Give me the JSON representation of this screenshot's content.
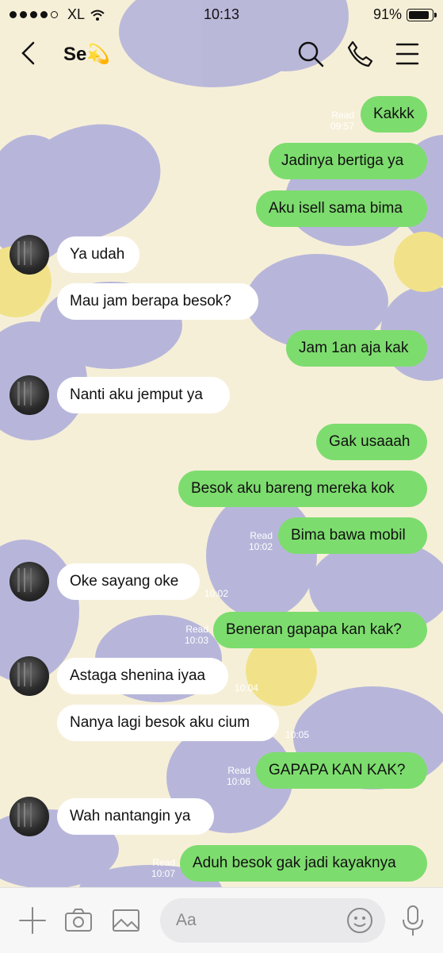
{
  "status_bar": {
    "carrier": "XL",
    "time": "10:13",
    "battery": "91%",
    "battery_level": 0.91
  },
  "header": {
    "title": "Se💫"
  },
  "messages": [
    {
      "side": "out",
      "text": "Kakkk",
      "read": "Read",
      "time": "09:57"
    },
    {
      "side": "out",
      "text": "Jadinya bertiga ya",
      "read": "",
      "time": ""
    },
    {
      "side": "out",
      "text": "Aku isell sama bima",
      "read": "",
      "time": ""
    },
    {
      "side": "in",
      "text": "Ya udah",
      "time": ""
    },
    {
      "side": "in",
      "text": "Mau jam berapa besok?",
      "time": ""
    },
    {
      "side": "out",
      "text": "Jam 1an aja kak",
      "read": "",
      "time": ""
    },
    {
      "side": "in",
      "text": "Nanti aku jemput ya",
      "time": ""
    },
    {
      "side": "out",
      "text": "Gak usaaah",
      "read": "",
      "time": ""
    },
    {
      "side": "out",
      "text": "Besok aku bareng mereka kok",
      "read": "",
      "time": ""
    },
    {
      "side": "out",
      "text": "Bima bawa mobil",
      "read": "Read",
      "time": "10:02"
    },
    {
      "side": "in",
      "text": "Oke sayang oke",
      "time": "10:02"
    },
    {
      "side": "out",
      "text": "Beneran gapapa kan kak?",
      "read": "Read",
      "time": "10:03"
    },
    {
      "side": "in",
      "text": "Astaga shenina iyaa",
      "time": "10:04"
    },
    {
      "side": "in",
      "text": "Nanya lagi besok aku cium",
      "time": "10:05"
    },
    {
      "side": "out",
      "text": "GAPAPA KAN KAK?",
      "read": "Read",
      "time": "10:06"
    },
    {
      "side": "in",
      "text": "Wah nantangin ya",
      "time": ""
    },
    {
      "side": "out",
      "text": "Aduh besok gak jadi kayaknya",
      "read": "Read",
      "time": "10:07"
    }
  ],
  "composer": {
    "placeholder": "Aa"
  },
  "colors": {
    "outgoing_bubble": "#7ddc6e",
    "incoming_bubble": "#ffffff",
    "flower": "#b7b6da",
    "flower_center": "#f1e28a",
    "background": "#f6efd8"
  }
}
